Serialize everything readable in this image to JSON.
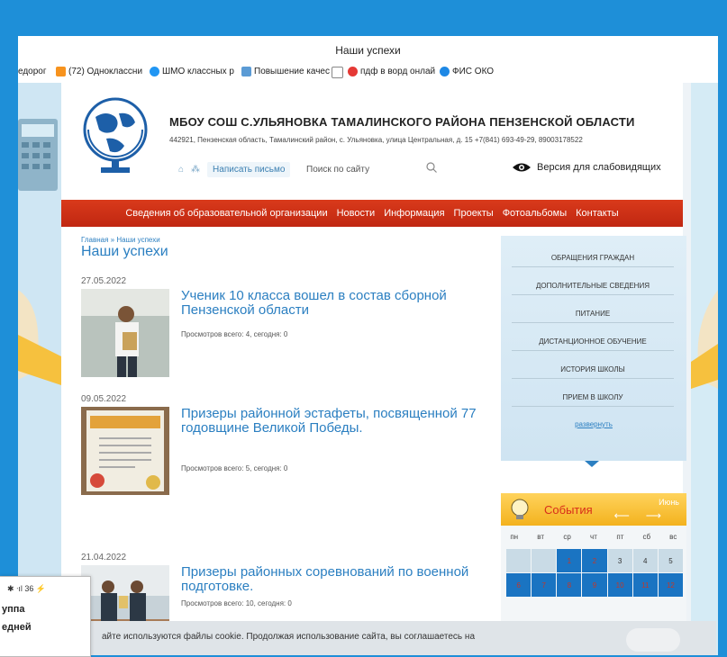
{
  "window": {
    "title": "Наши успехи"
  },
  "bookmarks": [
    {
      "label": "едорог",
      "color": "#ffffff"
    },
    {
      "label": "(72) Одноклассни",
      "color": "#f7931e"
    },
    {
      "label": "ШМО классных р",
      "color": "#2196f3"
    },
    {
      "label": "Повышение качес",
      "color": "#5b9bd5"
    },
    {
      "label": "",
      "color": "#ffffff"
    },
    {
      "label": "пдф в ворд онлай",
      "color": "#e53935"
    },
    {
      "label": "ФИС ОКО",
      "color": "#1e88e5"
    }
  ],
  "header": {
    "title": "МБОУ СОШ С.УЛЬЯНОВКА ТАМАЛИНСКОГО РАЙОНА ПЕНЗЕНСКОЙ ОБЛАСТИ",
    "address": "442921, Пензенская область, Тамалинский район, с. Ульяновка, улица Центральная, д. 15     +7(841) 693-49-29, 89003178522",
    "write_label": "Написать письмо",
    "search_placeholder": "Поиск по сайту",
    "vision_label": "Версия для слабовидящих"
  },
  "nav": [
    "Сведения об образовательной организации",
    "Новости",
    "Информация",
    "Проекты",
    "Фотоальбомы",
    "Контакты"
  ],
  "breadcrumb": "Главная » Наши успехи",
  "page_title": "Наши успехи",
  "posts": [
    {
      "date": "27.05.2022",
      "title": "Ученик 10 класса вошел в состав сборной Пензенской области",
      "views": "Просмотров всего: 4, сегодня: 0"
    },
    {
      "date": "09.05.2022",
      "title": "Призеры районной эстафеты, посвященной 77 годовщине Великой Победы.",
      "views": "Просмотров всего: 5, сегодня: 0"
    },
    {
      "date": "21.04.2022",
      "title": "Призеры районных соревнований по военной подготовке.",
      "views": "Просмотров всего: 10, сегодня: 0"
    }
  ],
  "sidebar": {
    "items": [
      "ОБРАЩЕНИЯ ГРАЖДАН",
      "ДОПОЛНИТЕЛЬНЫЕ СВЕДЕНИЯ",
      "ПИТАНИЕ",
      "ДИСТАНЦИОННОЕ ОБУЧЕНИЕ",
      "ИСТОРИЯ ШКОЛЫ",
      "ПРИЕМ В ШКОЛУ"
    ],
    "more": "развернуть"
  },
  "events": {
    "title": "События",
    "month": "Июнь",
    "weekdays": [
      "пн",
      "вт",
      "ср",
      "чт",
      "пт",
      "сб",
      "вс"
    ],
    "row1": [
      "",
      "",
      "1",
      "2",
      "3",
      "4",
      "5"
    ],
    "row2": [
      "6",
      "7",
      "8",
      "9",
      "10",
      "11",
      "12"
    ]
  },
  "cookie": {
    "text": "айте используются файлы cookie. Продолжая использование сайта, вы соглашаетесь на"
  },
  "phone": {
    "status": "✱ ᐧıl 36 ⚡",
    "line1": "уппа",
    "line2": "едней"
  }
}
